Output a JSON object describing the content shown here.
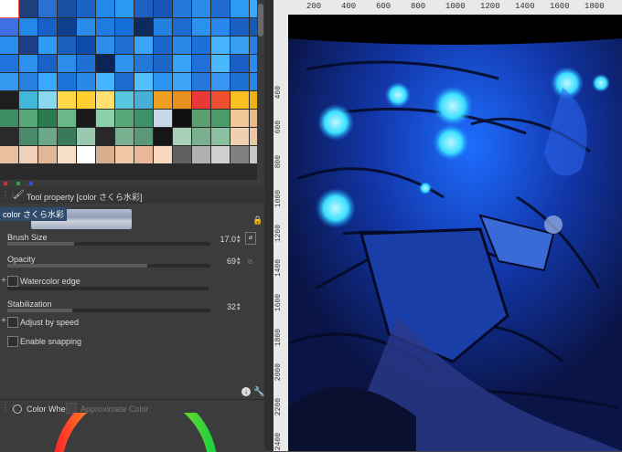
{
  "swatches": {
    "rows": [
      [
        "#ffffff",
        "#1e3f7a",
        "#2b6fd0",
        "#1a4fa0",
        "#1c63c8",
        "#2488e8",
        "#2a9af0",
        "#1e5fc4",
        "#1955b8",
        "#2478d8",
        "#2a8ce8",
        "#1e6cd0",
        "#2d9af6",
        "#3aa8ff"
      ],
      [
        "#3f6fe0",
        "#2488e8",
        "#1660c8",
        "#0f3f8f",
        "#2a8ce8",
        "#1e7ce0",
        "#1470d8",
        "#0e2a5c",
        "#2480e0",
        "#1c6cd0",
        "#2c90ee",
        "#2888f0",
        "#1a60c0",
        "#165ab4"
      ],
      [
        "#2a8cec",
        "#1e3f84",
        "#2e9af4",
        "#1a5fbc",
        "#0e4aa8",
        "#2c8ee8",
        "#2070d4",
        "#3aa4f8",
        "#1a66cc",
        "#2a88e4",
        "#1c70d8",
        "#48b4ff",
        "#3a9ef0",
        "#2a80e0"
      ],
      [
        "#1e74dc",
        "#2c90f0",
        "#1862c8",
        "#2c8cea",
        "#1e70d4",
        "#0c2456",
        "#2e94ee",
        "#2678d8",
        "#1c66c8",
        "#36a2f8",
        "#2070d8",
        "#4ab8ff",
        "#1a60c4",
        "#2e8ae8"
      ],
      [
        "#3498f0",
        "#2680e0",
        "#3aa8fc",
        "#1c74d8",
        "#2a88e8",
        "#46b4ff",
        "#1e6cd0",
        "#52c0ff",
        "#2c94f0",
        "#3ea6f8",
        "#2478dc",
        "#3896f0",
        "#1e70d4",
        "#2a86e4"
      ],
      [
        "#1e1e1e",
        "#42b8d8",
        "#8ad8f0",
        "#ffd84a",
        "#ffd030",
        "#ffe070",
        "#58c8e0",
        "#48b0d8",
        "#f0a020",
        "#e89020",
        "#e83838",
        "#f05030",
        "#f8c020",
        "#f0b018"
      ],
      [
        "#3e8e62",
        "#5aa878",
        "#2a7a50",
        "#6ab888",
        "#1a1a1a",
        "#8ad0a8",
        "#58a878",
        "#3e9068",
        "#c8d8e8",
        "#101010",
        "#5aa070",
        "#4a9a6a",
        "#f0c898",
        "#e8b888"
      ],
      [
        "#2a2a2a",
        "#4a8a6a",
        "#6aa888",
        "#3a7a5a",
        "#9ac8b0",
        "#282828",
        "#78b090",
        "#5a9878",
        "#161616",
        "#a8d0b8",
        "#7ab090",
        "#88c0a0",
        "#f0d0b0",
        "#e8c8a8"
      ],
      [
        "#e8c0a0",
        "#f0d0b8",
        "#e0b898",
        "#f8e0c8",
        "#ffffff",
        "#d8b090",
        "#f0c8a8",
        "#e8b898",
        "#f8d8c0",
        "#606060",
        "#b0b0b0",
        "#d0d0d0",
        "#808080",
        "#c8c8c8"
      ]
    ],
    "footer_colors": [
      "#d03030",
      "#30a030",
      "#3050d0"
    ]
  },
  "tool_property": {
    "title": "Tool property [color さくら水彩]",
    "brush_name": "color さくら水彩",
    "brush_size": {
      "label": "Brush Size",
      "value": "17.0",
      "fraction": 0.33
    },
    "opacity": {
      "label": "Opacity",
      "value": "69",
      "fraction": 0.69
    },
    "watercolor_edge": {
      "label": "Watercolor edge"
    },
    "stabilization": {
      "label": "Stabilization",
      "value": "32",
      "fraction": 0.32
    },
    "adjust_by_speed": {
      "label": "Adjust by speed"
    },
    "enable_snapping": {
      "label": "Enable snapping"
    }
  },
  "color_panel": {
    "tab_wheel": "Color Wheel",
    "tab_approx": "Approximate Color"
  },
  "ruler": {
    "top_labels": [
      "200",
      "400",
      "600",
      "800",
      "1000",
      "1200",
      "1400",
      "1600",
      "1800"
    ],
    "left_labels": [
      "400",
      "600",
      "800",
      "1000",
      "1200",
      "1400",
      "1600",
      "1800",
      "2000",
      "2200",
      "2400"
    ]
  }
}
